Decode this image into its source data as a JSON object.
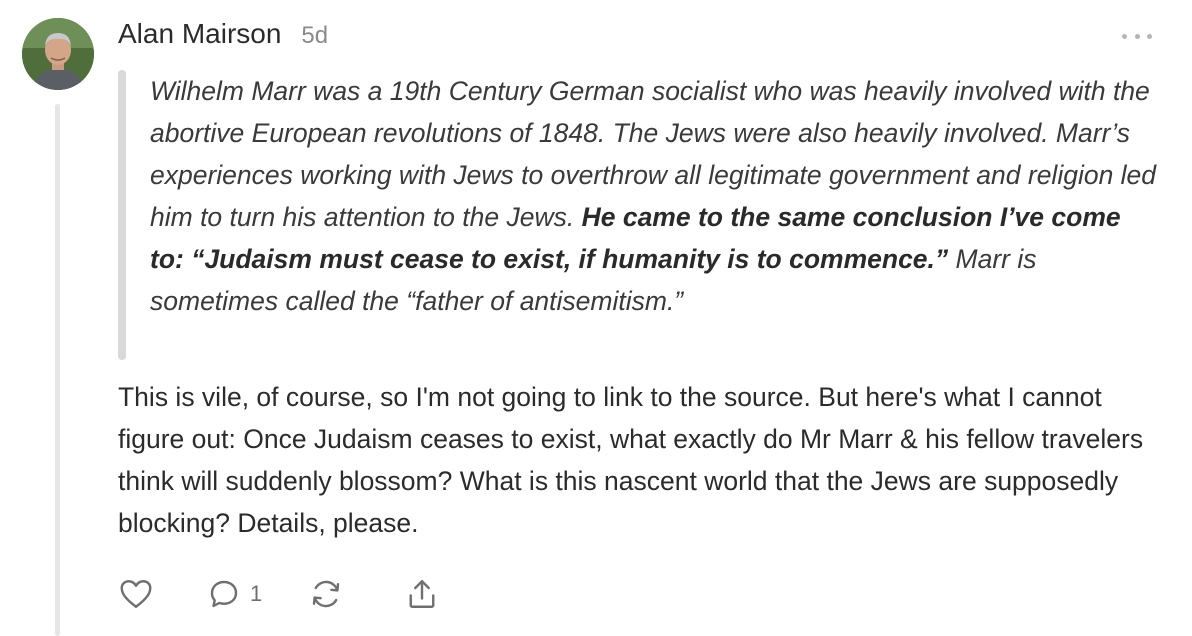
{
  "comment": {
    "author": "Alan Mairson",
    "time": "5d",
    "quote": {
      "part1": "Wilhelm Marr was a 19th Century German socialist who was heavily involved with the abortive European revolutions of 1848. The Jews were also heavily involved. Marr’s experiences working with Jews to overthrow all legitimate government and religion led him to turn his attention to the Jews. ",
      "bold": "He came to the same conclusion I’ve come to: “Judaism must cease to exist, if humanity is to commence.”",
      "part2": " Marr is sometimes called the “father of antisemitism.”"
    },
    "body": "This is vile, of course, so I'm not going to link to the source. But here's what I cannot figure out: Once Judaism ceases to exist, what exactly do Mr Marr & his fellow travelers think will suddenly blossom? What is this nascent world that the Jews are supposedly blocking? Details, please.",
    "actions": {
      "like_icon": "heart-icon",
      "reply_icon": "comment-bubble-icon",
      "reply_count": "1",
      "restack_icon": "restack-icon",
      "share_icon": "share-icon"
    }
  }
}
